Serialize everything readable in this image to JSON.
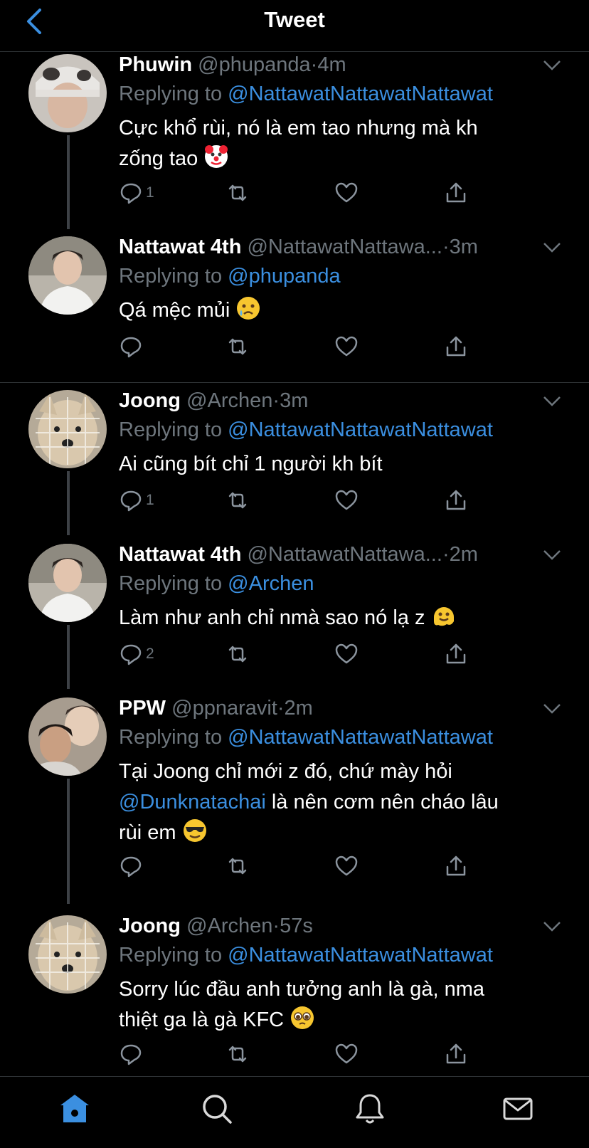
{
  "header": {
    "title": "Tweet",
    "back_icon": "chevron-left-icon"
  },
  "colors": {
    "background": "#000000",
    "accent": "#3b8fe0",
    "muted": "#6e767d",
    "divider": "#2f3336"
  },
  "tweets": [
    {
      "name": "Phuwin",
      "handle": "@phupanda",
      "sep": "·",
      "time": "4m",
      "reply_prefix": "Replying to ",
      "reply_to": "@NattawatNattawatNattawat",
      "body_lines": [
        "Cực khổ rùi, nó là em tao nhưng mà kh",
        "zống tao"
      ],
      "emoji": "clown-face",
      "reply_count": "1"
    },
    {
      "name": "Nattawat 4th",
      "handle": "@NattawatNattawa...",
      "sep": "·",
      "time": "3m",
      "reply_prefix": "Replying to ",
      "reply_to": "@phupanda",
      "body_lines": [
        "Qá mệc mủi"
      ],
      "emoji": "crying-face",
      "reply_count": ""
    },
    {
      "name": "Joong",
      "handle": "@Archen",
      "sep": "·",
      "time": "3m",
      "reply_prefix": "Replying to ",
      "reply_to": "@NattawatNattawatNattawat",
      "body_lines": [
        "Ai cũng bít chỉ 1 người kh bít"
      ],
      "emoji": "",
      "reply_count": "1"
    },
    {
      "name": "Nattawat 4th",
      "handle": "@NattawatNattawa...",
      "sep": "·",
      "time": "2m",
      "reply_prefix": "Replying to ",
      "reply_to": "@Archen",
      "body_lines": [
        "Làm như anh chỉ nmà sao nó lạ z"
      ],
      "emoji": "melting-face",
      "reply_count": "2"
    },
    {
      "name": "PPW",
      "handle": "@ppnaravit",
      "sep": "·",
      "time": "2m",
      "reply_prefix": "Replying to ",
      "reply_to": "@NattawatNattawatNattawat",
      "body_line1": "Tại Joong chỉ mới z đó, chứ mày hỏi",
      "body_mention": "@Dunknatachai",
      "body_line2_rest": " là nên cơm nên cháo lâu",
      "body_line3": "rùi em",
      "emoji": "sunglasses-face",
      "reply_count": ""
    },
    {
      "name": "Joong",
      "handle": "@Archen",
      "sep": "·",
      "time": "57s",
      "reply_prefix": "Replying to ",
      "reply_to": "@NattawatNattawatNattawat",
      "body_lines": [
        "Sorry lúc đầu anh tưởng anh là gà, nma",
        "thiệt ga là gà KFC"
      ],
      "emoji": "pleading-face",
      "reply_count": ""
    }
  ],
  "tabbar": [
    {
      "icon": "home-icon",
      "active": true
    },
    {
      "icon": "search-icon",
      "active": false
    },
    {
      "icon": "notifications-bell-icon",
      "active": false
    },
    {
      "icon": "messages-envelope-icon",
      "active": false
    }
  ]
}
